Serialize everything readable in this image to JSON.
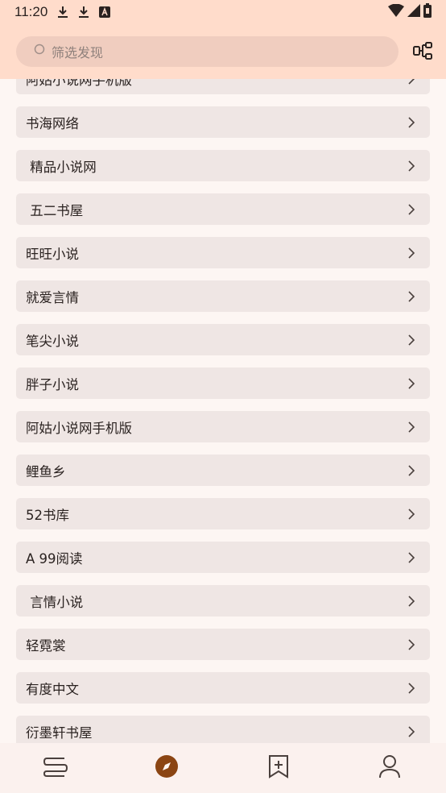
{
  "status_bar": {
    "time": "11:20",
    "left_icons": [
      "download-icon",
      "download-icon",
      "app-notification-icon"
    ],
    "right_icons": [
      "wifi-icon",
      "signal-icon",
      "battery-icon"
    ]
  },
  "search": {
    "placeholder": "筛选发现"
  },
  "toolbar": {
    "graph_icon": "group-tree-icon"
  },
  "sources": [
    "阿姑小说网手机版",
    "书海网络",
    " 精品小说网",
    " 五二书屋",
    "旺旺小说",
    "就爱言情",
    "笔尖小说",
    "胖子小说",
    "阿姑小说网手机版",
    "鲤鱼乡",
    "52书库",
    "A 99阅读",
    " 言情小说",
    "轻霓裳",
    "有度中文",
    "衍墨轩书屋"
  ],
  "bottom_nav": {
    "items": [
      "bookshelf-icon",
      "explore-icon",
      "rss-bookmark-icon",
      "profile-icon"
    ],
    "active_index": 1
  },
  "colors": {
    "top_bar": "#ffdccb",
    "search_field": "#f0cdbf",
    "list_item": "#efe6e4",
    "background": "#fdf6f3",
    "accent": "#8b4513"
  }
}
